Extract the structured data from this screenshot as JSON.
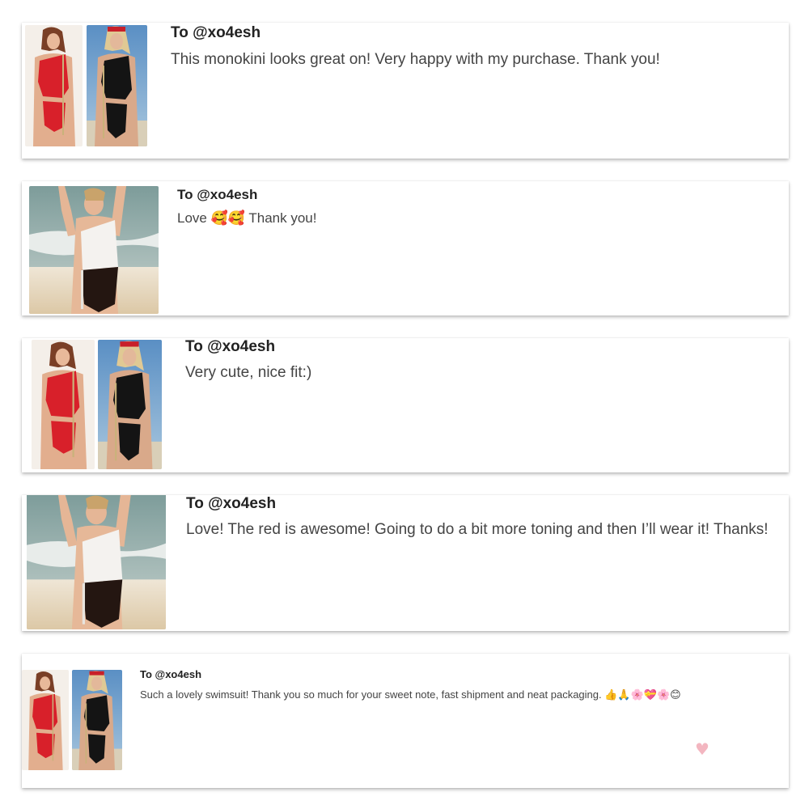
{
  "reviews": [
    {
      "to": "To @xo4esh",
      "message": "This monokini looks great on! Very happy with my purchase. Thank you!",
      "photos": [
        "red-swimsuit-photo",
        "black-swimsuit-photo"
      ]
    },
    {
      "to": "To @xo4esh",
      "message_prefix": "Love ",
      "message_emoji": "🥰🥰",
      "message_suffix": " Thank you!",
      "photos": [
        "white-black-swimsuit-photo"
      ]
    },
    {
      "to": "To @xo4esh",
      "message": "Very cute, nice fit:)",
      "photos": [
        "red-swimsuit-photo",
        "black-swimsuit-photo"
      ]
    },
    {
      "to": "To @xo4esh",
      "message": "Love! The red is awesome! Going to do a bit more toning and then I’ll wear it! Thanks!",
      "photos": [
        "white-black-swimsuit-photo"
      ]
    },
    {
      "to": "To @xo4esh",
      "message": "Such a lovely swimsuit! Thank you so much for your sweet note, fast shipment and neat packaging. ",
      "message_emoji": "👍🙏🌸💝🌸😊",
      "like_icon": "heart-icon",
      "photos": [
        "red-swimsuit-photo",
        "black-swimsuit-photo"
      ]
    }
  ],
  "colors": {
    "red_suit": "#d8202a",
    "black_suit": "#141414",
    "heart": "#f3b6c0",
    "card_bg": "#ffffff"
  }
}
